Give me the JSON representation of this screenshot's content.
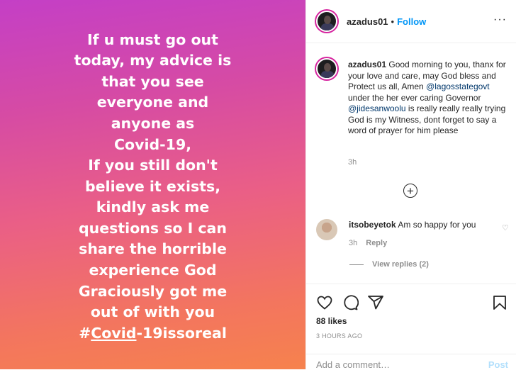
{
  "story": {
    "lines": [
      "If u must go out",
      "today, my advice is",
      "that you see",
      "everyone and",
      "anyone as",
      "Covid-19,",
      "If you still don't",
      "believe it exists,",
      "kindly ask me",
      "questions so I can",
      "share the horrible",
      "experience God",
      "Graciously got me",
      "out of with you"
    ],
    "hashtag_prefix": "#",
    "hashtag_underlined": "Covid",
    "hashtag_suffix": "-19issoreal"
  },
  "header": {
    "username": "azadus01",
    "separator": "•",
    "follow_label": "Follow",
    "more_label": "···"
  },
  "caption": {
    "username": "azadus01",
    "text_part1": " Good morning to you, thanx for your love and care, may God bless and Protect us all, Amen ",
    "mention1": "@lagosstategovt",
    "text_part2": " under the her ever caring Governor ",
    "mention2": "@jidesanwoolu",
    "text_part3": " is really really really trying God is my Witness, dont forget to say a word of prayer for him please",
    "time": "3h"
  },
  "load_more_icon": "plus-circle-icon",
  "comment": {
    "username": "itsobeyetok",
    "text": "Am so happy for you",
    "time": "3h",
    "reply_label": "Reply",
    "view_replies": "View replies (2)"
  },
  "footer": {
    "likes": "88 likes",
    "time_ago": "3 HOURS AGO",
    "add_comment_placeholder": "Add a comment…",
    "post_label": "Post",
    "post_color": "#b2dffc"
  },
  "colors": {
    "link_blue": "#0095f6",
    "mention_blue": "#00376b",
    "muted": "#8e8e8e"
  }
}
